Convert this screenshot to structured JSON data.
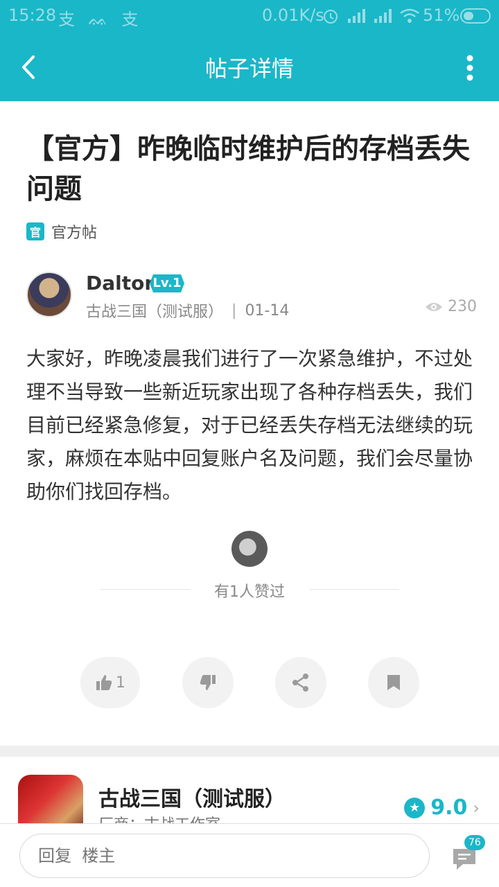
{
  "status_bar": {
    "time": "15:28",
    "notification_icons": "支 ᨐ 支",
    "net_speed": "0.01K/s",
    "battery_percent": "51%"
  },
  "app_bar": {
    "title": "帖子详情"
  },
  "post": {
    "title": "【官方】昨晚临时维护后的存档丢失问题",
    "tag_badge": "官",
    "tag_label": "官方帖",
    "author": {
      "name": "Dalton",
      "level": "Lv.1",
      "server": "古战三国（测试服）",
      "separator": "|",
      "date": "01-14",
      "views": "230"
    },
    "body": "大家好，昨晚凌晨我们进行了一次紧急维护，不过处理不当导致一些新近玩家出现了各种存档丢失，我们目前已经紧急修复，对于已经丢失存档无法继续的玩家，麻烦在本贴中回复账户名及问题，我们会尽量协助你们找回存档。",
    "liked_text": "有1人赞过",
    "like_count": "1"
  },
  "game_card": {
    "name": "古战三国（测试服）",
    "developer": "厂商：古战工作室",
    "rating": "9.0"
  },
  "reply_bar": {
    "placeholder": "回复  楼主",
    "comment_count": "76"
  },
  "colors": {
    "accent": "#1ab7c8"
  }
}
